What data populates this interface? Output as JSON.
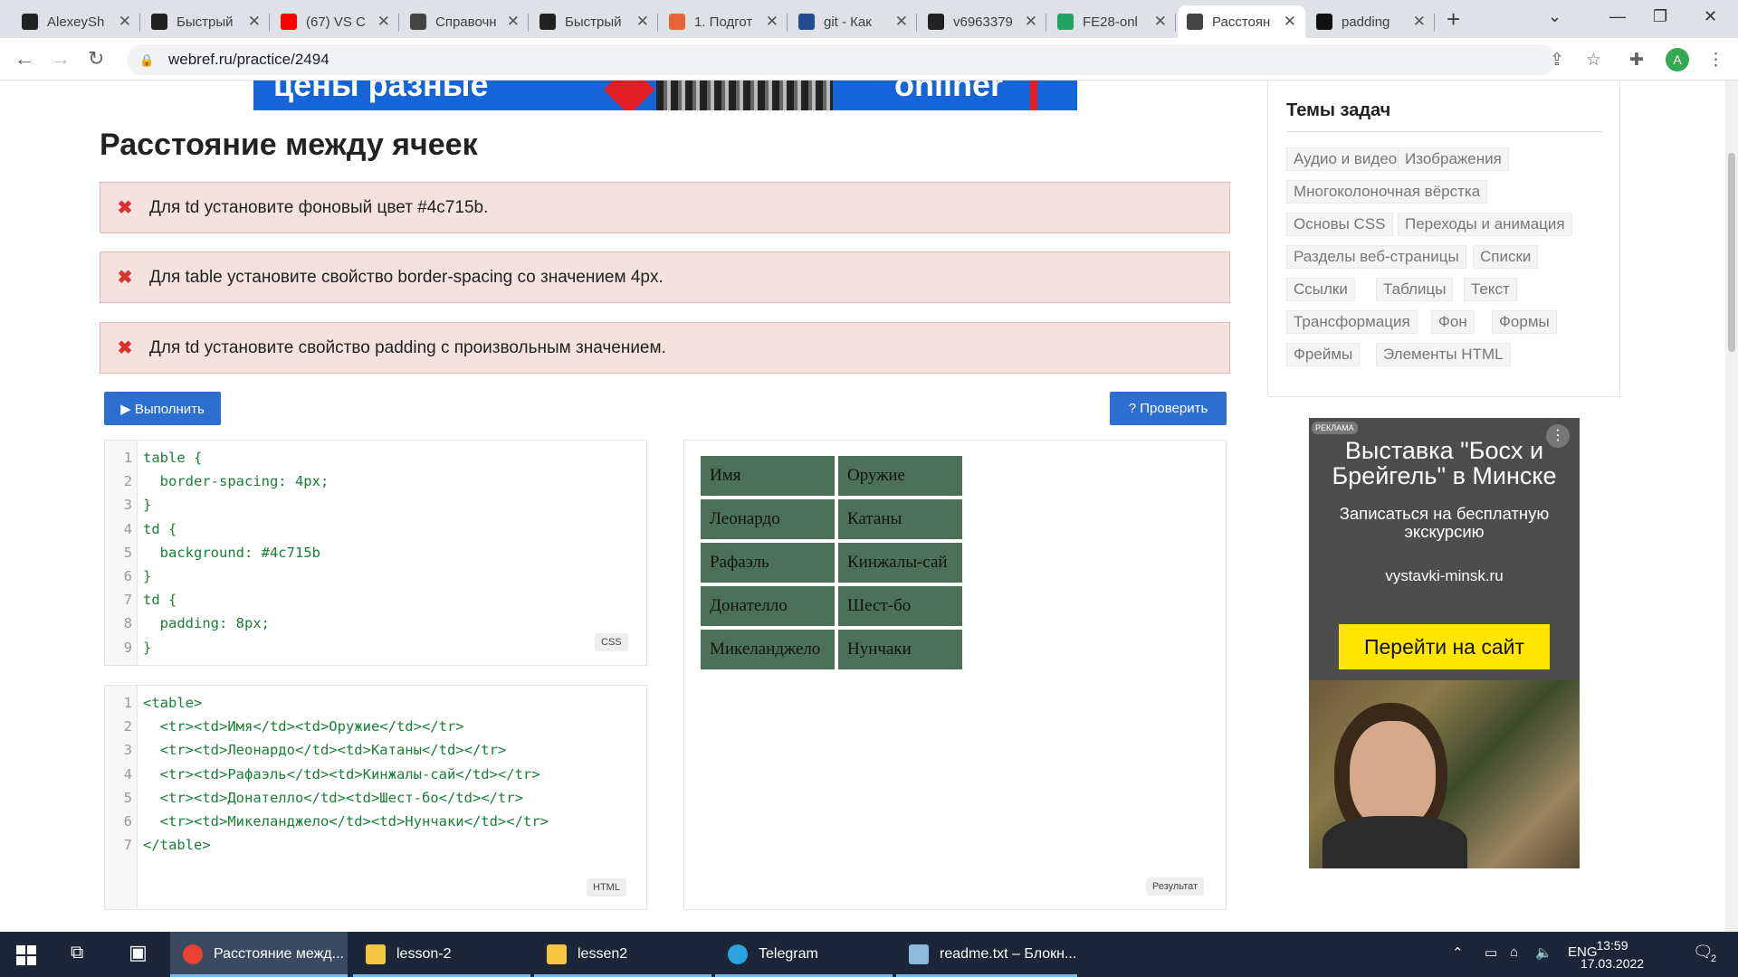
{
  "browser": {
    "tabs": [
      {
        "title": "AlexeySh",
        "favicon": "github-icon",
        "color": "#222222"
      },
      {
        "title": "Быстрый",
        "favicon": "document-icon",
        "color": "#222222"
      },
      {
        "title": "(67) VS C",
        "favicon": "youtube-icon",
        "color": "#ff0000"
      },
      {
        "title": "Справочн",
        "favicon": "chat-icon",
        "color": "#444444"
      },
      {
        "title": "Быстрый",
        "favicon": "document-icon",
        "color": "#222222"
      },
      {
        "title": "1. Подгот",
        "favicon": "tool-icon",
        "color": "#e8623a"
      },
      {
        "title": "git - Как",
        "favicon": "stackoverflow-icon",
        "color": "#244d8f"
      },
      {
        "title": "v6963379",
        "favicon": "github-icon",
        "color": "#222222"
      },
      {
        "title": "FE28-onl",
        "favicon": "drive-icon",
        "color": "#1fa463"
      },
      {
        "title": "Расстоян",
        "favicon": "chat-icon",
        "color": "#444444",
        "active": true
      },
      {
        "title": "padding",
        "favicon": "mdn-icon",
        "color": "#111111"
      }
    ],
    "url": "webref.ru/practice/2494",
    "avatar_letter": "A"
  },
  "banner": {
    "left_text": "цены разные",
    "right_text": "onliner"
  },
  "page_title": "Расстояние между ячеек",
  "errors": [
    "Для td установите фоновый цвет #4c715b.",
    "Для table установите свойство border-spacing со значением 4px.",
    "Для td установите свойство padding с произвольным значением."
  ],
  "buttons": {
    "run": "▶ Выполнить",
    "check": "? Проверить"
  },
  "css_editor": {
    "lang": "CSS",
    "lines": [
      "table {",
      "  border-spacing: 4px;",
      "}",
      "td {",
      "  background: #4c715b",
      "}",
      "td {",
      "  padding: 8px;",
      "}"
    ]
  },
  "html_editor": {
    "lang": "HTML",
    "lines": [
      "<table>",
      "  <tr><td>Имя</td><td>Оружие</td></tr>",
      "  <tr><td>Леонардо</td><td>Катаны</td></tr>",
      "  <tr><td>Рафаэль</td><td>Кинжалы-сай</td></tr>",
      "  <tr><td>Донателло</td><td>Шест-бо</td></tr>",
      "  <tr><td>Микеланджело</td><td>Нунчаки</td></tr>",
      "</table>"
    ]
  },
  "result": {
    "label": "Результат",
    "rows": [
      [
        "Имя",
        "Оружие"
      ],
      [
        "Леонардо",
        "Катаны"
      ],
      [
        "Рафаэль",
        "Кинжалы-сай"
      ],
      [
        "Донателло",
        "Шест-бо"
      ],
      [
        "Микеланджело",
        "Нунчаки"
      ]
    ],
    "cell_color": "#4c715b"
  },
  "sidebar": {
    "title": "Темы задач",
    "topics": [
      "Аудио и видео",
      "Изображения",
      "Многоколоночная вёрстка",
      "Основы CSS",
      "Переходы и анимация",
      "Разделы веб-страницы",
      "Списки",
      "Ссылки",
      "Таблицы",
      "Текст",
      "Трансформация",
      "Фон",
      "Формы",
      "Фреймы",
      "Элементы HTML"
    ]
  },
  "ad": {
    "label": "РЕКЛАМА",
    "headline": "Выставка \"Босх и Брейгель\" в Минске",
    "sub": "Записаться на бесплатную экскурсию",
    "site": "vystavki-minsk.ru",
    "cta": "Перейти на сайт"
  },
  "taskbar": {
    "items": [
      {
        "label": "Расстояние межд...",
        "icon": "chrome-icon",
        "active": true
      },
      {
        "label": "lesson-2",
        "icon": "folder-icon"
      },
      {
        "label": "lessen2",
        "icon": "folder-icon"
      },
      {
        "label": "Telegram",
        "icon": "telegram-icon"
      },
      {
        "label": "readme.txt – Блокн...",
        "icon": "notepad-icon"
      }
    ],
    "lang": "ENG",
    "time": "13:59",
    "date": "17.03.2022",
    "notifications": "2"
  }
}
